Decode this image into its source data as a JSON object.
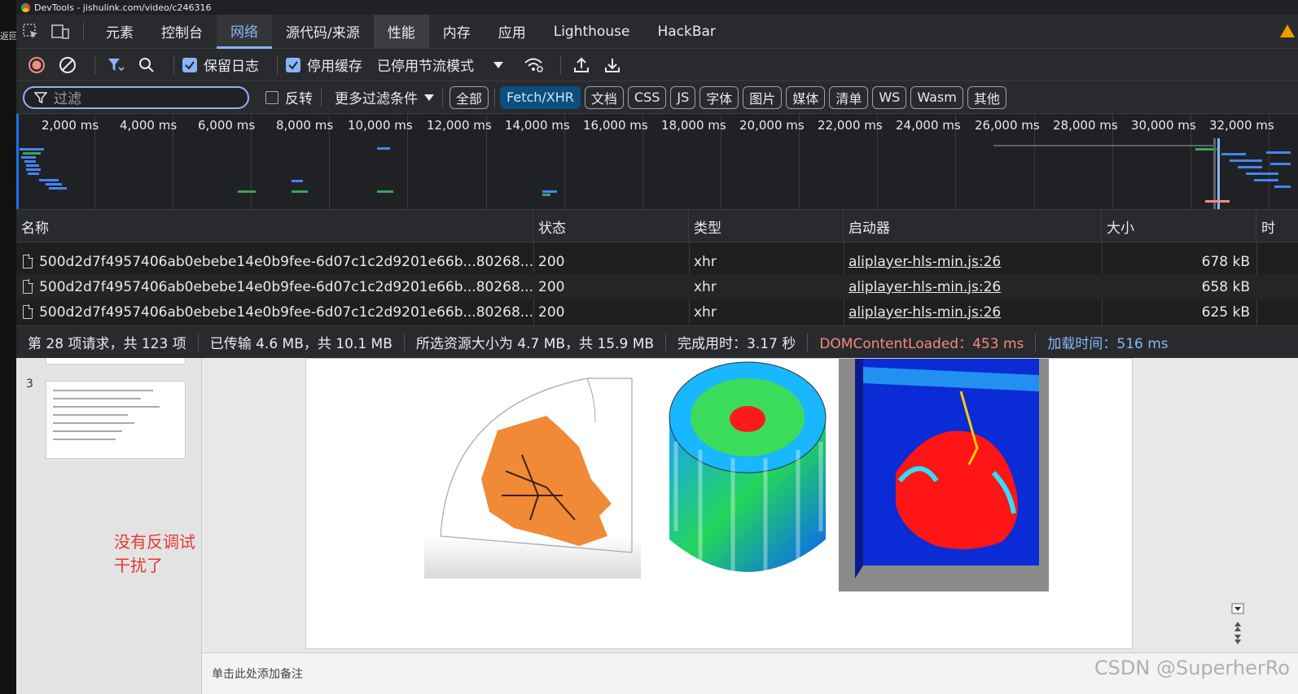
{
  "window": {
    "title": "DevTools - jishulink.com/video/c246316"
  },
  "left_stripe_text": "返回读",
  "tabs": [
    {
      "label": "元素"
    },
    {
      "label": "控制台"
    },
    {
      "label": "网络"
    },
    {
      "label": "源代码/来源"
    },
    {
      "label": "性能"
    },
    {
      "label": "内存"
    },
    {
      "label": "应用"
    },
    {
      "label": "Lighthouse"
    },
    {
      "label": "HackBar"
    }
  ],
  "active_tab": "网络",
  "toolbar": {
    "preserve_log": "保留日志",
    "preserve_log_checked": true,
    "disable_cache": "停用缓存",
    "disable_cache_checked": true,
    "throttling": "已停用节流模式"
  },
  "filter": {
    "placeholder": "过滤",
    "invert_label": "反转",
    "more_filters": "更多过滤条件",
    "type_pills": [
      "全部",
      "Fetch/XHR",
      "文档",
      "CSS",
      "JS",
      "字体",
      "图片",
      "媒体",
      "清单",
      "WS",
      "Wasm",
      "其他"
    ],
    "active_pill": "Fetch/XHR"
  },
  "timeline": {
    "ticks": [
      "2,000 ms",
      "4,000 ms",
      "6,000 ms",
      "8,000 ms",
      "10,000 ms",
      "12,000 ms",
      "14,000 ms",
      "16,000 ms",
      "18,000 ms",
      "20,000 ms",
      "22,000 ms",
      "24,000 ms",
      "26,000 ms",
      "28,000 ms",
      "30,000 ms",
      "32,000 ms"
    ]
  },
  "table": {
    "columns": [
      "名称",
      "状态",
      "类型",
      "启动器",
      "大小",
      "时"
    ],
    "rows": [
      {
        "name": "500d2d7f4957406ab0ebebe14e0b9fee-6d07c1c2d9201e66b...80268...",
        "status": "200",
        "type": "xhr",
        "initiator": "aliplayer-hls-min.js:26",
        "size": "678 kB"
      },
      {
        "name": "500d2d7f4957406ab0ebebe14e0b9fee-6d07c1c2d9201e66b...80268...",
        "status": "200",
        "type": "xhr",
        "initiator": "aliplayer-hls-min.js:26",
        "size": "658 kB"
      },
      {
        "name": "500d2d7f4957406ab0ebebe14e0b9fee-6d07c1c2d9201e66b...80268...",
        "status": "200",
        "type": "xhr",
        "initiator": "aliplayer-hls-min.js:26",
        "size": "625 kB"
      }
    ]
  },
  "status": {
    "requests": "第 28 项请求，共 123 项",
    "transferred": "已传输 4.6 MB，共 10.1 MB",
    "resources": "所选资源大小为 4.7 MB，共 15.9 MB",
    "finish": "完成用时：3.17 秒",
    "dcl": "DOMContentLoaded：453 ms",
    "load": "加载时间：516 ms"
  },
  "ppt": {
    "slide_number": "3",
    "annotation": "没有反调试干扰了",
    "notes_placeholder": "单击此处添加备注"
  },
  "watermark": "CSDN @SuperherRo"
}
